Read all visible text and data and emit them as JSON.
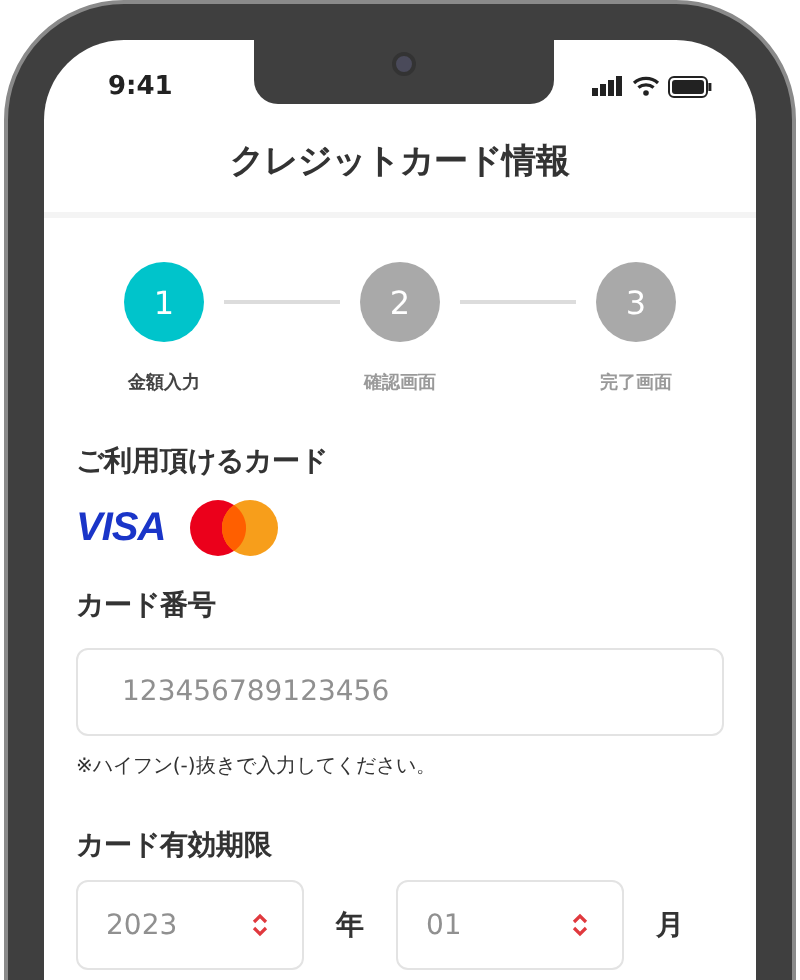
{
  "status_bar": {
    "time": "9:41"
  },
  "header": {
    "title": "クレジットカード情報"
  },
  "steps": [
    {
      "number": "1",
      "label": "金額入力",
      "selected": true
    },
    {
      "number": "2",
      "label": "確認画面",
      "selected": false
    },
    {
      "number": "3",
      "label": "完了画面",
      "selected": false
    }
  ],
  "accepted_cards": {
    "label": "ご利用頂けるカード",
    "visa_logo": "VISA"
  },
  "card_number": {
    "label": "カード番号",
    "placeholder": "123456789123456",
    "note": "※ハイフン(-)抜きで入力してください。"
  },
  "expiry": {
    "label": "カード有効期限",
    "year": {
      "placeholder": "2023",
      "unit": "年"
    },
    "month": {
      "placeholder": "01",
      "unit": "月"
    }
  }
}
